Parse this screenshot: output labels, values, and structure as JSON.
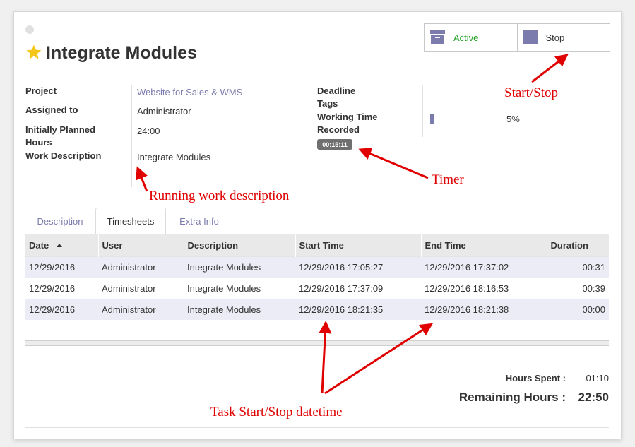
{
  "task": {
    "title": "Integrate Modules"
  },
  "stage_buttons": {
    "active_label": "Active",
    "stop_label": "Stop"
  },
  "fields_left": {
    "project_label": "Project",
    "project_value": "Website for Sales & WMS",
    "assigned_label": "Assigned to",
    "assigned_value": "Administrator",
    "planned_label_1": "Initially Planned",
    "planned_label_2": "Hours",
    "planned_value": "24:00",
    "work_desc_label": "Work Description",
    "work_desc_value": "Integrate Modules"
  },
  "fields_right": {
    "deadline_label": "Deadline",
    "tags_label": "Tags",
    "working_time_label_1": "Working Time",
    "working_time_label_2": "Recorded",
    "timer_value": "00:15:11",
    "progress_text": "5%",
    "progress_fraction": 0.05
  },
  "tabs": [
    "Description",
    "Timesheets",
    "Extra Info"
  ],
  "table": {
    "headers": [
      "Date",
      "User",
      "Description",
      "Start Time",
      "End Time",
      "Duration"
    ],
    "rows": [
      [
        "12/29/2016",
        "Administrator",
        "Integrate Modules",
        "12/29/2016 17:05:27",
        "12/29/2016 17:37:02",
        "00:31"
      ],
      [
        "12/29/2016",
        "Administrator",
        "Integrate Modules",
        "12/29/2016 17:37:09",
        "12/29/2016 18:16:53",
        "00:39"
      ],
      [
        "12/29/2016",
        "Administrator",
        "Integrate Modules",
        "12/29/2016 18:21:35",
        "12/29/2016 18:21:38",
        "00:00"
      ]
    ]
  },
  "totals": {
    "hours_spent_label": "Hours Spent :",
    "hours_spent_value": "01:10",
    "remaining_label": "Remaining Hours :",
    "remaining_value": "22:50"
  },
  "annotations": {
    "start_stop": "Start/Stop",
    "timer": "Timer",
    "running_desc": "Running work description",
    "datetime": "Task Start/Stop datetime"
  },
  "colors": {
    "accent": "#7c7bad",
    "active_green": "#21a121",
    "annotation_red": "#e00000",
    "star": "#f5c518"
  },
  "icons": [
    "star-icon",
    "archive-icon",
    "stop-icon",
    "sort-asc-icon"
  ]
}
